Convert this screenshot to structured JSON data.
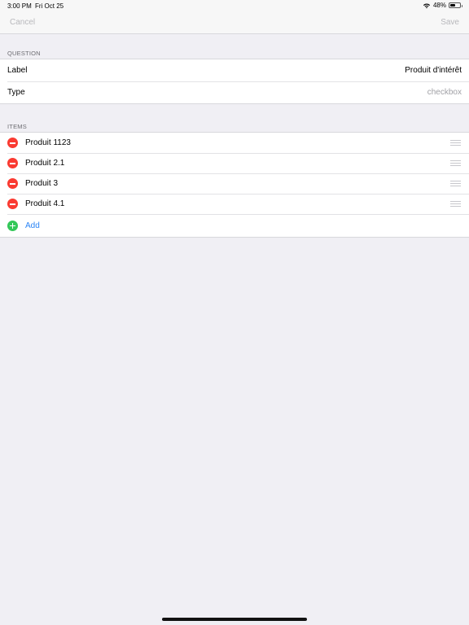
{
  "status_bar": {
    "time": "3:00 PM",
    "date": "Fri Oct 25",
    "battery_text": "48%",
    "battery_level": 0.48
  },
  "nav": {
    "cancel_label": "Cancel",
    "save_label": "Save"
  },
  "question_section": {
    "header": "QUESTION",
    "rows": [
      {
        "label": "Label",
        "value": "Produit d'intérêt"
      },
      {
        "label": "Type",
        "value": "checkbox"
      }
    ]
  },
  "items_section": {
    "header": "ITEMS",
    "items": [
      {
        "label": "Produit 1123"
      },
      {
        "label": "Produit 2.1"
      },
      {
        "label": "Produit 3"
      },
      {
        "label": "Produit 4.1"
      }
    ],
    "add_label": "Add"
  },
  "colors": {
    "delete": "#fa3b32",
    "add": "#34c759",
    "link": "#2a84f5",
    "background": "#f0eff4"
  },
  "icons": {
    "delete": "minus-circle-icon",
    "add": "plus-circle-icon",
    "reorder": "drag-handle-icon",
    "wifi": "wifi-icon",
    "battery": "battery-icon"
  }
}
